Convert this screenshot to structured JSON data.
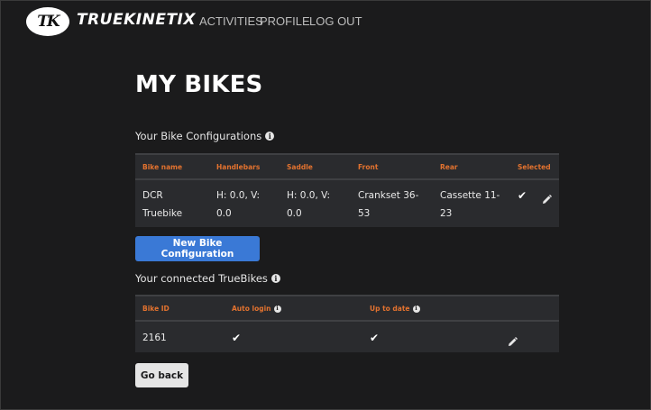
{
  "header": {
    "logo_initials": "TK",
    "brand_name": "TRUEKINETIX",
    "nav": [
      {
        "label": "ACTIVITIES"
      },
      {
        "label": "PROFILE"
      },
      {
        "label": "LOG OUT"
      }
    ]
  },
  "page": {
    "title": "MY BIKES"
  },
  "configs": {
    "section_label": "Your Bike Configurations",
    "info_icon": "info-icon",
    "columns": [
      "Bike name",
      "Handlebars",
      "Saddle",
      "Front",
      "Rear",
      "Selected"
    ],
    "rows": [
      {
        "bike_name": "DCR Truebike",
        "handlebars": "H: 0.0, V: 0.0",
        "saddle": "H: 0.0, V: 0.0",
        "front": "Crankset 36-53",
        "rear": "Cassette 11-23",
        "selected": true,
        "selected_icon": "check-icon",
        "edit_icon": "pencil-icon"
      }
    ],
    "new_button_label": "New Bike Configuration"
  },
  "truebikes": {
    "section_label": "Your connected TrueBikes",
    "info_icon": "info-icon",
    "columns": [
      "Bike ID",
      "Auto login",
      "Up to date",
      ""
    ],
    "rows": [
      {
        "bike_id": "2161",
        "auto_login": true,
        "up_to_date": true,
        "edit_icon": "pencil-icon"
      }
    ]
  },
  "footer": {
    "back_button_label": "Go back"
  },
  "colors": {
    "background": "#1b1b1c",
    "table_bg": "#2a2b2e",
    "header_accent": "#e2722f",
    "primary_button": "#3a79d6",
    "secondary_button": "#e5e5e5"
  }
}
